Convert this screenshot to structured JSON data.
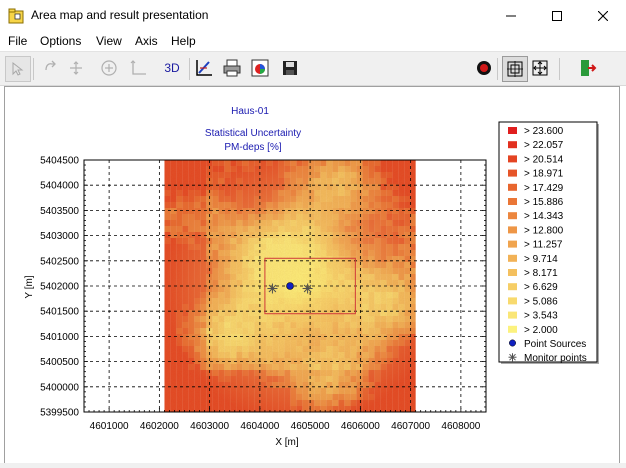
{
  "window": {
    "title": "Area map and result presentation",
    "icon": "app-folder-icon",
    "controls": [
      "minimize-icon",
      "maximize-icon",
      "close-icon"
    ]
  },
  "menu": {
    "items": [
      {
        "label": "File"
      },
      {
        "label": "Options"
      },
      {
        "label": "View"
      },
      {
        "label": "Axis"
      },
      {
        "label": "Help"
      }
    ]
  },
  "toolbar": {
    "three_d_label": "3D",
    "icons": [
      "select-tool-icon",
      "pan-tool-icon",
      "move-tool-icon",
      "zoom-tool-icon",
      "measure-tool-icon",
      "3d-button",
      "axis-settings-icon",
      "print-icon",
      "legend-colors-icon",
      "save-icon",
      "record-icon",
      "fit-view-icon",
      "expand-view-icon",
      "exit-icon"
    ]
  },
  "chart_data": {
    "type": "heatmap",
    "title": "Haus-01",
    "subtitle_line1": "Statistical Uncertainty",
    "subtitle_line2": "PM-deps [%]",
    "xlabel": "X [m]",
    "ylabel": "Y [m]",
    "xlim": [
      4600500,
      4608500
    ],
    "ylim": [
      5399500,
      5404500
    ],
    "x_ticks": [
      "4601000",
      "4602000",
      "4603000",
      "4604000",
      "4605000",
      "4606000",
      "4607000",
      "4608000"
    ],
    "y_ticks": [
      "5399500",
      "5400000",
      "5400500",
      "5401000",
      "5401500",
      "5402000",
      "5402500",
      "5403000",
      "5403500",
      "5404000",
      "5404500"
    ],
    "x_tick_values": [
      4601000,
      4602000,
      4603000,
      4604000,
      4605000,
      4606000,
      4607000,
      4608000
    ],
    "y_tick_values": [
      5399500,
      5400000,
      5400500,
      5401000,
      5401500,
      5402000,
      5402500,
      5403000,
      5403500,
      5404000,
      5404500
    ],
    "grid": true,
    "raster_extent": {
      "x": [
        4602100,
        4607100
      ],
      "y": [
        5399500,
        5404500
      ]
    },
    "selection_box": {
      "x": [
        4604100,
        4605900
      ],
      "y": [
        5401450,
        5402550
      ]
    },
    "point_sources": [
      {
        "x": 4604600,
        "y": 5402000
      }
    ],
    "monitor_points": [
      {
        "x": 4604250,
        "y": 5401950
      },
      {
        "x": 4604950,
        "y": 5401950
      }
    ],
    "legend_position": "right",
    "legend": [
      {
        "label": "> 23.600",
        "color": "#e01e1e"
      },
      {
        "label": "> 22.057",
        "color": "#e2301f"
      },
      {
        "label": "> 20.514",
        "color": "#e44422"
      },
      {
        "label": "> 18.971",
        "color": "#e65528"
      },
      {
        "label": "> 17.429",
        "color": "#e8662e"
      },
      {
        "label": "> 15.886",
        "color": "#ea7636"
      },
      {
        "label": "> 14.343",
        "color": "#ec863e"
      },
      {
        "label": "> 12.800",
        "color": "#ee9646"
      },
      {
        "label": "> 11.257",
        "color": "#f0a44e"
      },
      {
        "label": "> 9.714",
        "color": "#f2b256"
      },
      {
        "label": "> 8.171",
        "color": "#f4c05e"
      },
      {
        "label": "> 6.629",
        "color": "#f6ce66"
      },
      {
        "label": "> 5.086",
        "color": "#f8da6e"
      },
      {
        "label": "> 3.543",
        "color": "#fae676"
      },
      {
        "label": "> 2.000",
        "color": "#fcf27e"
      }
    ],
    "legend_point_sources": "Point Sources",
    "legend_monitor_points": "Monitor points"
  }
}
